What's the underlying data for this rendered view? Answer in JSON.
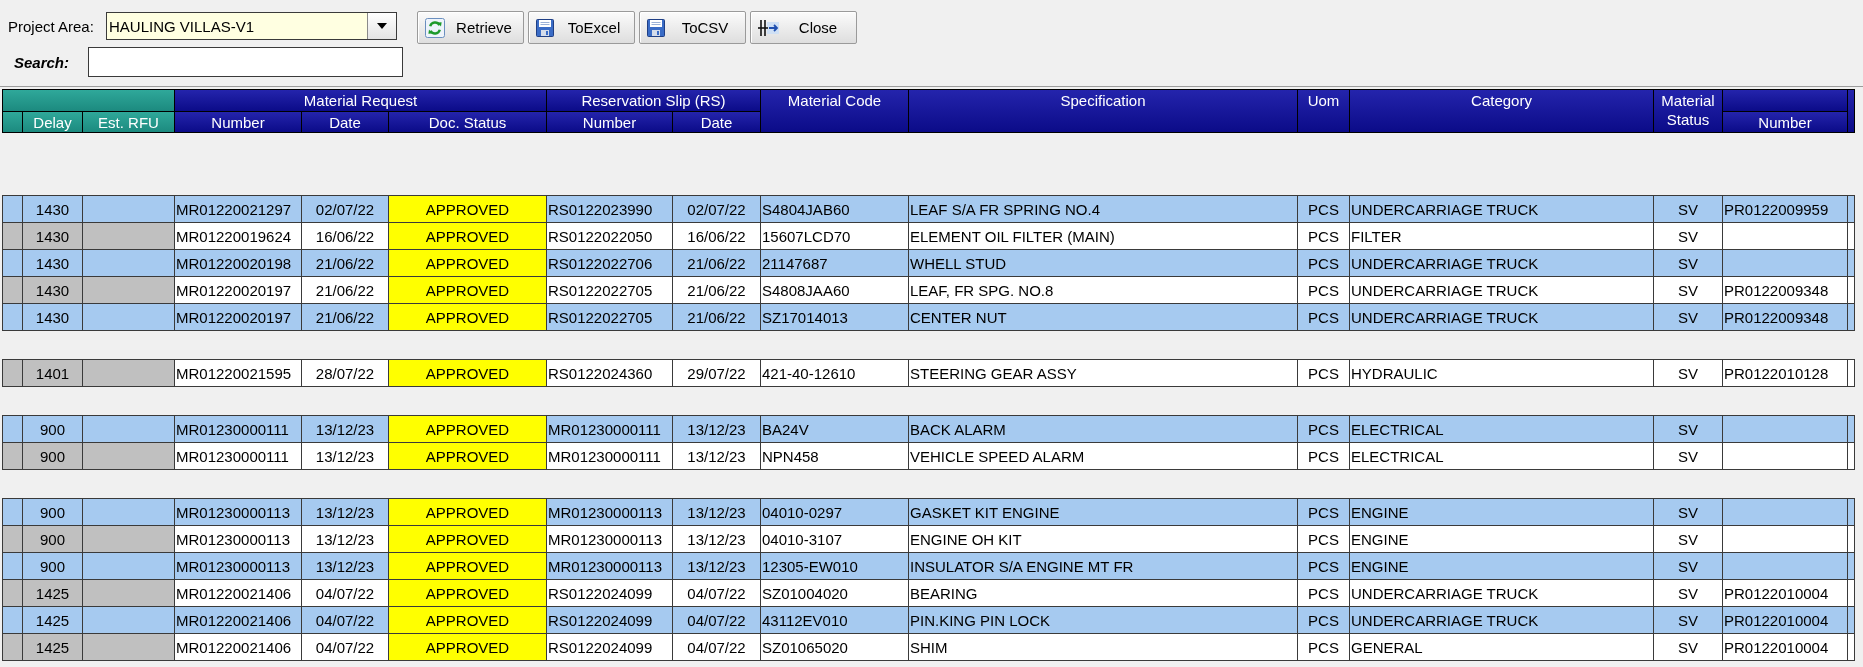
{
  "toolbar": {
    "project_area": {
      "label": "Project Area:",
      "value": "HAULING VILLAS-V1"
    },
    "search": {
      "label": "Search:"
    },
    "buttons": [
      {
        "label": "Retrieve",
        "kind": "refresh"
      },
      {
        "label": "ToExcel",
        "kind": "save"
      },
      {
        "label": "ToCSV",
        "kind": "save"
      },
      {
        "label": "Close",
        "kind": "close"
      }
    ]
  },
  "table": {
    "header": [
      {
        "kind": "frozen",
        "columns": [
          "Delay",
          "Est. RFU"
        ]
      },
      {
        "kind": "group",
        "label": "Material Request",
        "columns": [
          "Number",
          "Date",
          "Doc. Status"
        ]
      },
      {
        "kind": "group",
        "label": "Reservation Slip (RS)",
        "columns": [
          "Number",
          "Date"
        ]
      },
      {
        "kind": "single",
        "label": "Material Code"
      },
      {
        "kind": "single",
        "label": "Specification"
      },
      {
        "kind": "single",
        "label": "Uom"
      },
      {
        "kind": "single",
        "label": "Category"
      },
      {
        "kind": "single",
        "label": "Material Status"
      },
      {
        "kind": "group",
        "columns": [
          "Number"
        ]
      }
    ],
    "groups": [
      {
        "rows": [
          {
            "delay": "1430",
            "mr_number": "MR01220021297",
            "mr_date": "02/07/22",
            "doc_status": "APPROVED",
            "rs_number": "RS0122023990",
            "rs_date": "02/07/22",
            "material_code": "S4804JAB60",
            "specification": "LEAF S/A FR SPRING NO.4",
            "uom": "PCS",
            "category": "UNDERCARRIAGE TRUCK",
            "material_status": "SV",
            "number": "PR0122009959"
          },
          {
            "delay": "1430",
            "mr_number": "MR01220019624",
            "mr_date": "16/06/22",
            "doc_status": "APPROVED",
            "rs_number": "RS0122022050",
            "rs_date": "16/06/22",
            "material_code": "15607LCD70",
            "specification": "ELEMENT OIL FILTER (MAIN)",
            "uom": "PCS",
            "category": "FILTER",
            "material_status": "SV"
          },
          {
            "delay": "1430",
            "mr_number": "MR01220020198",
            "mr_date": "21/06/22",
            "doc_status": "APPROVED",
            "rs_number": "RS0122022706",
            "rs_date": "21/06/22",
            "material_code": "21147687",
            "specification": "WHELL STUD",
            "uom": "PCS",
            "category": "UNDERCARRIAGE TRUCK",
            "material_status": "SV"
          },
          {
            "delay": "1430",
            "mr_number": "MR01220020197",
            "mr_date": "21/06/22",
            "doc_status": "APPROVED",
            "rs_number": "RS0122022705",
            "rs_date": "21/06/22",
            "material_code": "S4808JAA60",
            "specification": "LEAF, FR SPG. NO.8",
            "uom": "PCS",
            "category": "UNDERCARRIAGE TRUCK",
            "material_status": "SV",
            "number": "PR0122009348"
          },
          {
            "delay": "1430",
            "mr_number": "MR01220020197",
            "mr_date": "21/06/22",
            "doc_status": "APPROVED",
            "rs_number": "RS0122022705",
            "rs_date": "21/06/22",
            "material_code": "SZ17014013",
            "specification": "CENTER NUT",
            "uom": "PCS",
            "category": "UNDERCARRIAGE TRUCK",
            "material_status": "SV",
            "number": "PR0122009348"
          }
        ]
      },
      {
        "rows": [
          {
            "delay": "1401",
            "mr_number": "MR01220021595",
            "mr_date": "28/07/22",
            "doc_status": "APPROVED",
            "rs_number": "RS0122024360",
            "rs_date": "29/07/22",
            "material_code": "421-40-12610",
            "specification": "STEERING GEAR ASSY",
            "uom": "PCS",
            "category": "HYDRAULIC",
            "material_status": "SV",
            "number": "PR0122010128"
          }
        ]
      },
      {
        "rows": [
          {
            "delay": "900",
            "mr_number": "MR01230000111",
            "mr_date": "13/12/23",
            "doc_status": "APPROVED",
            "rs_number": "MR01230000111",
            "rs_date": "13/12/23",
            "material_code": "BA24V",
            "specification": "BACK ALARM",
            "uom": "PCS",
            "category": "ELECTRICAL",
            "material_status": "SV"
          },
          {
            "delay": "900",
            "mr_number": "MR01230000111",
            "mr_date": "13/12/23",
            "doc_status": "APPROVED",
            "rs_number": "MR01230000111",
            "rs_date": "13/12/23",
            "material_code": "NPN458",
            "specification": "VEHICLE SPEED ALARM",
            "uom": "PCS",
            "category": "ELECTRICAL",
            "material_status": "SV"
          }
        ]
      },
      {
        "rows": [
          {
            "delay": "900",
            "mr_number": "MR01230000113",
            "mr_date": "13/12/23",
            "doc_status": "APPROVED",
            "rs_number": "MR01230000113",
            "rs_date": "13/12/23",
            "material_code": "04010-0297",
            "specification": "GASKET KIT ENGINE",
            "uom": "PCS",
            "category": "ENGINE",
            "material_status": "SV"
          },
          {
            "delay": "900",
            "mr_number": "MR01230000113",
            "mr_date": "13/12/23",
            "doc_status": "APPROVED",
            "rs_number": "MR01230000113",
            "rs_date": "13/12/23",
            "material_code": "04010-3107",
            "specification": "ENGINE OH KIT",
            "uom": "PCS",
            "category": "ENGINE",
            "material_status": "SV"
          },
          {
            "delay": "900",
            "mr_number": "MR01230000113",
            "mr_date": "13/12/23",
            "doc_status": "APPROVED",
            "rs_number": "MR01230000113",
            "rs_date": "13/12/23",
            "material_code": "12305-EW010",
            "specification": "INSULATOR S/A ENGINE MT FR",
            "uom": "PCS",
            "category": "ENGINE",
            "material_status": "SV"
          },
          {
            "delay": "1425",
            "mr_number": "MR01220021406",
            "mr_date": "04/07/22",
            "doc_status": "APPROVED",
            "rs_number": "RS0122024099",
            "rs_date": "04/07/22",
            "material_code": "SZ01004020",
            "specification": "BEARING",
            "uom": "PCS",
            "category": "UNDERCARRIAGE TRUCK",
            "material_status": "SV",
            "number": "PR0122010004"
          },
          {
            "delay": "1425",
            "mr_number": "MR01220021406",
            "mr_date": "04/07/22",
            "doc_status": "APPROVED",
            "rs_number": "RS0122024099",
            "rs_date": "04/07/22",
            "material_code": "43112EV010",
            "specification": "PIN.KING PIN LOCK",
            "uom": "PCS",
            "category": "UNDERCARRIAGE TRUCK",
            "material_status": "SV",
            "number": "PR0122010004"
          },
          {
            "delay": "1425",
            "mr_number": "MR01220021406",
            "mr_date": "04/07/22",
            "doc_status": "APPROVED",
            "rs_number": "RS0122024099",
            "rs_date": "04/07/22",
            "material_code": "SZ01065020",
            "specification": "SHIM",
            "uom": "PCS",
            "category": "GENERAL",
            "material_status": "SV",
            "number": "PR0122010004"
          }
        ]
      }
    ]
  }
}
